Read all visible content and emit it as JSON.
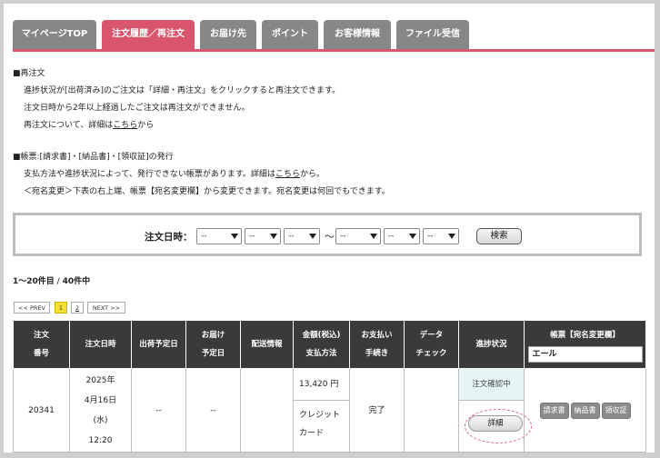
{
  "tabs": [
    {
      "label": "マイページTOP"
    },
    {
      "label": "注文履歴／再注文"
    },
    {
      "label": "お届け先"
    },
    {
      "label": "ポイント"
    },
    {
      "label": "お客様情報"
    },
    {
      "label": "ファイル受信"
    }
  ],
  "info": {
    "reorder_heading": "■再注文",
    "reorder_line1": "進捗状況が[出荷済み]のご注文は「詳細・再注文」をクリックすると再注文できます。",
    "reorder_line2": "注文日時から2年以上経過したご注文は再注文ができません。",
    "reorder_line3_prefix": "再注文について、詳細は",
    "reorder_line3_link": "こちら",
    "reorder_line3_suffix": "から",
    "docs_heading": "■帳票:[請求書]・[納品書]・[領収証]の発行",
    "docs_line1_prefix": "支払方法や進捗状況によって、発行できない帳票があります。詳細は",
    "docs_line1_link": "こちら",
    "docs_line1_suffix": "から。",
    "docs_line2": "＜宛名変更＞下表の右上端、帳票【宛名変更欄】から変更できます。宛名変更は何回でもできます。"
  },
  "search": {
    "label": "注文日時：",
    "selects": [
      "--",
      "--",
      "--",
      "--",
      "--",
      "--"
    ],
    "tilde": "〜",
    "button": "検索"
  },
  "result_count": {
    "range": "1〜20件目",
    "separator": " / ",
    "total": "40件中"
  },
  "pager": {
    "prev": "<< PREV",
    "pages": [
      "1",
      "2"
    ],
    "next": "NEXT >>"
  },
  "table": {
    "headers": [
      "注文\n番号",
      "注文日時",
      "出荷予定日",
      "お届け\n予定日",
      "配送情報",
      "金額(税込)\n支払方法",
      "お支払い\n手続き",
      "データ\nチェック",
      "進捗状況",
      "帳票【宛名変更欄】"
    ],
    "header_lines": {
      "order_no": [
        "注文",
        "番号"
      ],
      "delivery": [
        "お届け",
        "予定日"
      ],
      "amount": [
        "金額(税込)",
        "支払方法"
      ],
      "payment": [
        "お支払い",
        "手続き"
      ],
      "data": [
        "データ",
        "チェック"
      ]
    },
    "account_name": "エール",
    "rows": [
      {
        "order_no": "20341",
        "date_lines": [
          "2025年",
          "4月16日",
          "(水)",
          "12:20"
        ],
        "ship_date": "--",
        "delivery_date": "--",
        "shipping_info": "",
        "amount": "13,420 円",
        "payment_lines": [
          "クレジット",
          "カード"
        ],
        "payment_proc": "完了",
        "data_check": "",
        "status": "注文確認中",
        "detail_button": "詳細",
        "docs": [
          "請求書",
          "納品書",
          "領収証"
        ]
      }
    ]
  },
  "colors": {
    "accent": "#d9556e",
    "tab_inactive": "#878787",
    "header_dark": "#3a3a3a",
    "highlight": "#e0609a"
  }
}
